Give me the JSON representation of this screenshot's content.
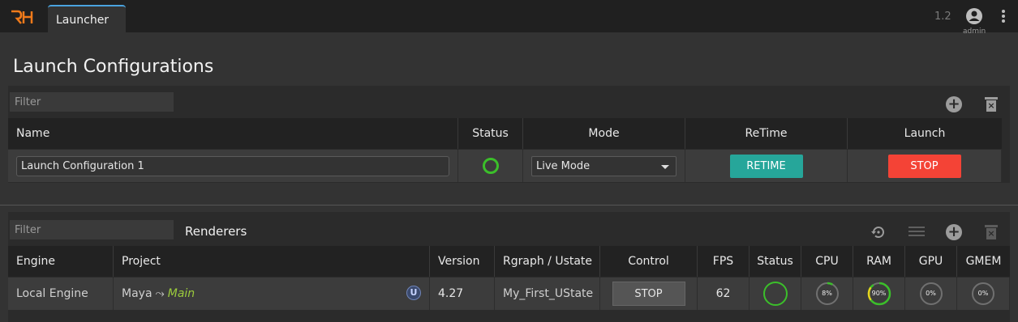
{
  "app": {
    "logo": "RH",
    "tab_label": "Launcher",
    "version": "1.2",
    "user_label": "admin"
  },
  "page": {
    "title": "Launch Configurations"
  },
  "configs": {
    "filter_placeholder": "Filter",
    "columns": [
      "Name",
      "Status",
      "Mode",
      "ReTime",
      "Launch"
    ],
    "row": {
      "name": "Launch Configuration 1",
      "mode": "Live Mode",
      "retime_label": "RETIME",
      "launch_label": "STOP"
    }
  },
  "renderers": {
    "title": "Renderers",
    "filter_placeholder": "Filter",
    "columns": [
      "Engine",
      "Project",
      "Version",
      "Rgraph / Ustate",
      "Control",
      "FPS",
      "Status",
      "CPU",
      "RAM",
      "GPU",
      "GMEM"
    ],
    "row": {
      "engine": "Local Engine",
      "project": "Maya",
      "arrow": "⤳",
      "project_ustate": "Main",
      "engine_icon": "U",
      "version": "4.27",
      "rgraph": "My_First_UState",
      "control_label": "STOP",
      "fps": "62",
      "cpu": "8%",
      "ram": "90%",
      "gpu": "0%",
      "gmem": "0%"
    },
    "gauge_values": {
      "cpu": 8,
      "ram": 90,
      "gpu": 0,
      "gmem": 0
    }
  },
  "colors": {
    "accent": "#4aa3df",
    "logo": "#f07a1a",
    "status_ok": "#3bbf2a",
    "retime": "#26a69a",
    "stop": "#f44336",
    "ram_warn": "#e8d21e",
    "ustate": "#9ccc3c"
  },
  "icons": [
    "rh-logo-icon",
    "account-circle-icon",
    "more-vert-icon",
    "add-circle-icon",
    "delete-icon",
    "history-icon",
    "list-icon",
    "chevron-down-icon",
    "unreal-engine-icon"
  ]
}
